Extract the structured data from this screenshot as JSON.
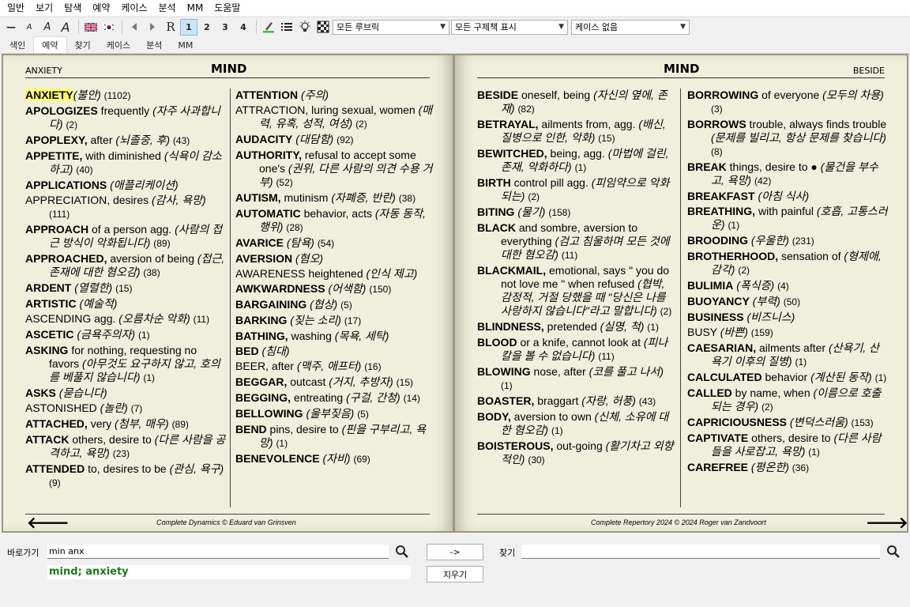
{
  "menu": [
    "일반",
    "보기",
    "탐색",
    "예약",
    "케이스",
    "분석",
    "MM",
    "도움말"
  ],
  "toolbar": {
    "size_buttons": [
      "—",
      "A",
      "A",
      "A"
    ],
    "r_label": "R",
    "level_buttons": [
      "1",
      "2",
      "3",
      "4"
    ],
    "rubric_filter": "모든 루브릭",
    "remedy_filter": "모든 구제책 표시",
    "case_select": "케이스 없음"
  },
  "tabs": [
    "색인",
    "예약",
    "찾기",
    "케이스",
    "분석",
    "MM"
  ],
  "left_page": {
    "header_left": "ANXIETY",
    "header_title": "MIND",
    "footer": "Complete Dynamics © Eduard van Grinsven",
    "col1": [
      {
        "b": "ANXIETY",
        "t": "",
        "i": "(불안)",
        "n": "(1102)",
        "hl": true
      },
      {
        "b": "APOLOGIZES",
        "t": " frequently ",
        "i": "(자주 사과합니다)",
        "n": "(2)"
      },
      {
        "b": "APOPLEXY,",
        "t": " after ",
        "i": "(뇌졸중, 후)",
        "n": "(43)"
      },
      {
        "b": "APPETITE,",
        "t": " with diminished ",
        "i": "(식욕이 감소하고)",
        "n": "(40)"
      },
      {
        "b": "APPLICATIONS",
        "t": " ",
        "i": "(애플리케이션)",
        "n": ""
      },
      {
        "b": "",
        "t": "APPRECIATION, desires ",
        "i": "(감사, 욕망)",
        "n": "(111)"
      },
      {
        "b": "APPROACH",
        "t": " of a person agg. ",
        "i": "(사람의 접근 방식이 악화됩니다)",
        "n": "(89)"
      },
      {
        "b": "APPROACHED,",
        "t": " aversion of being ",
        "i": "(접근, 존재에 대한 혐오감)",
        "n": "(38)"
      },
      {
        "b": "ARDENT",
        "t": " ",
        "i": "(열렬한)",
        "n": "(15)"
      },
      {
        "b": "ARTISTIC",
        "t": " ",
        "i": "(예술적)",
        "n": ""
      },
      {
        "b": "",
        "t": "ASCENDING agg. ",
        "i": "(오름차순 악화)",
        "n": "(11)"
      },
      {
        "b": "ASCETIC",
        "t": " ",
        "i": "(금욕주의자)",
        "n": "(1)"
      },
      {
        "b": "ASKING",
        "t": " for nothing, requesting no favors ",
        "i": "(아무것도 요구하지 않고, 호의를 베풀지 않습니다)",
        "n": "(1)"
      },
      {
        "b": "ASKS",
        "t": " ",
        "i": "(묻습니다)",
        "n": ""
      },
      {
        "b": "",
        "t": "ASTONISHED ",
        "i": "(놀란)",
        "n": "(7)"
      },
      {
        "b": "ATTACHED,",
        "t": " very ",
        "i": "(첨부, 매우)",
        "n": "(89)"
      },
      {
        "b": "ATTACK",
        "t": " others, desire to ",
        "i": "(다른 사람을 공격하고, 욕망)",
        "n": "(23)"
      },
      {
        "b": "ATTENDED",
        "t": " to, desires to be ",
        "i": "(관심, 욕구)",
        "n": "(9)"
      }
    ],
    "col2": [
      {
        "b": "ATTENTION",
        "t": " ",
        "i": "(주의)",
        "n": ""
      },
      {
        "b": "",
        "t": "ATTRACTION, luring sexual, women ",
        "i": "(매력, 유혹, 성적, 여성)",
        "n": "(2)"
      },
      {
        "b": "AUDACITY",
        "t": " ",
        "i": "(대담함)",
        "n": "(92)"
      },
      {
        "b": "AUTHORITY,",
        "t": " refusal to accept some one's ",
        "i": "(권위, 다른 사람의 의견 수용 거부)",
        "n": "(52)"
      },
      {
        "b": "AUTISM,",
        "t": " mutinism ",
        "i": "(자폐증, 반란)",
        "n": "(38)"
      },
      {
        "b": "AUTOMATIC",
        "t": " behavior, acts ",
        "i": "(자동 동작, 행위)",
        "n": "(28)"
      },
      {
        "b": "AVARICE",
        "t": " ",
        "i": "(탐욕)",
        "n": "(54)"
      },
      {
        "b": "AVERSION",
        "t": " ",
        "i": "(혐오)",
        "n": ""
      },
      {
        "b": "",
        "t": "AWARENESS heightened ",
        "i": "(인식 제고)",
        "n": ""
      },
      {
        "b": "AWKWARDNESS",
        "t": " ",
        "i": "(어색함)",
        "n": "(150)"
      },
      {
        "b": "BARGAINING",
        "t": " ",
        "i": "(협상)",
        "n": "(5)"
      },
      {
        "b": "BARKING",
        "t": " ",
        "i": "(짖는 소리)",
        "n": "(17)"
      },
      {
        "b": "BATHING,",
        "t": " washing ",
        "i": "(목욕, 세탁)",
        "n": ""
      },
      {
        "b": "BED",
        "t": " ",
        "i": "(침대)",
        "n": ""
      },
      {
        "b": "",
        "t": "BEER, after ",
        "i": "(맥주, 애프터)",
        "n": "(16)"
      },
      {
        "b": "BEGGAR,",
        "t": " outcast ",
        "i": "(거지, 추방자)",
        "n": "(15)"
      },
      {
        "b": "BEGGING,",
        "t": " entreating ",
        "i": "(구걸, 간청)",
        "n": "(14)"
      },
      {
        "b": "BELLOWING",
        "t": " ",
        "i": "(울부짖음)",
        "n": "(5)"
      },
      {
        "b": "BEND",
        "t": " pins, desire to ",
        "i": "(핀을 구부리고, 욕망)",
        "n": "(1)"
      },
      {
        "b": "BENEVOLENCE",
        "t": " ",
        "i": "(자비)",
        "n": "(69)"
      }
    ]
  },
  "right_page": {
    "header_title": "MIND",
    "header_right": "BESIDE",
    "footer": "Complete Repertory 2024 © 2024 Roger van Zandvoort",
    "col1": [
      {
        "b": "BESIDE",
        "t": " oneself, being ",
        "i": "(자신의 옆에, 존재)",
        "n": "(82)"
      },
      {
        "b": "BETRAYAL,",
        "t": " ailments from, agg. ",
        "i": "(배신, 질병으로 인한, 악화)",
        "n": "(15)"
      },
      {
        "b": "BEWITCHED,",
        "t": " being, agg. ",
        "i": "(마법에 걸린, 존재, 악화하다)",
        "n": "(1)"
      },
      {
        "b": "BIRTH",
        "t": " control pill agg. ",
        "i": "(피임약으로 악화되는)",
        "n": "(2)"
      },
      {
        "b": "BITING",
        "t": " ",
        "i": "(물기)",
        "n": "(158)"
      },
      {
        "b": "BLACK",
        "t": " and sombre, aversion to everything ",
        "i": "(검고 침울하며 모든 것에 대한 혐오감)",
        "n": "(11)"
      },
      {
        "b": "BLACKMAIL,",
        "t": " emotional, says \" you do not love me \" when refused ",
        "i": "(협박, 감정적, 거절 당했을 때 \"당신은 나를 사랑하지 않습니다\"라고 말합니다)",
        "n": "(2)"
      },
      {
        "b": "BLINDNESS,",
        "t": " pretended ",
        "i": "(실명, 척)",
        "n": "(1)"
      },
      {
        "b": "BLOOD",
        "t": " or a knife, cannot look at ",
        "i": "(피나 칼을 볼 수 없습니다)",
        "n": "(11)"
      },
      {
        "b": "BLOWING",
        "t": " nose, after ",
        "i": "(코를 풀고 나서)",
        "n": "(1)"
      },
      {
        "b": "BOASTER,",
        "t": " braggart ",
        "i": "(자랑, 허풍)",
        "n": "(43)"
      },
      {
        "b": "BODY,",
        "t": " aversion to own ",
        "i": "(신체, 소유에 대한 혐오감)",
        "n": "(1)"
      },
      {
        "b": "BOISTEROUS,",
        "t": " out-going ",
        "i": "(활기차고 외향적인)",
        "n": "(30)"
      }
    ],
    "col2": [
      {
        "b": "BORROWING",
        "t": " of everyone ",
        "i": "(모두의 차용)",
        "n": "(3)"
      },
      {
        "b": "BORROWS",
        "t": " trouble, always finds trouble ",
        "i": "(문제를 빌리고, 항상 문제를 찾습니다)",
        "n": "(8)"
      },
      {
        "b": "BREAK",
        "t": " things, desire to ● ",
        "i": "(물건을 부수고, 욕망)",
        "n": "(42)"
      },
      {
        "b": "BREAKFAST",
        "t": " ",
        "i": "(아침 식사)",
        "n": ""
      },
      {
        "b": "BREATHING,",
        "t": " with painful ",
        "i": "(호흡, 고통스러운)",
        "n": "(1)"
      },
      {
        "b": "BROODING",
        "t": " ",
        "i": "(우울한)",
        "n": "(231)"
      },
      {
        "b": "BROTHERHOOD,",
        "t": " sensation of ",
        "i": "(형제애, 감각)",
        "n": "(2)"
      },
      {
        "b": "BULIMIA",
        "t": " ",
        "i": "(폭식증)",
        "n": "(4)"
      },
      {
        "b": "BUOYANCY",
        "t": " ",
        "i": "(부력)",
        "n": "(50)"
      },
      {
        "b": "BUSINESS",
        "t": " ",
        "i": "(비즈니스)",
        "n": ""
      },
      {
        "b": "",
        "t": "BUSY ",
        "i": "(바쁜)",
        "n": "(159)"
      },
      {
        "b": "CAESARIAN,",
        "t": " ailments after ",
        "i": "(산욕기, 산욕기 이후의 질병)",
        "n": "(1)"
      },
      {
        "b": "CALCULATED",
        "t": " behavior ",
        "i": "(계산된 동작)",
        "n": "(1)"
      },
      {
        "b": "CALLED",
        "t": " by name, when ",
        "i": "(이름으로 호출되는 경우)",
        "n": "(2)"
      },
      {
        "b": "CAPRICIOUSNESS",
        "t": " ",
        "i": "(변덕스러움)",
        "n": "(153)"
      },
      {
        "b": "CAPTIVATE",
        "t": " others, desire to ",
        "i": "(다른 사람들을 사로잡고, 욕망)",
        "n": "(1)"
      },
      {
        "b": "CAREFREE",
        "t": " ",
        "i": "(평온한)",
        "n": "(36)"
      }
    ]
  },
  "bottom": {
    "goto_label": "바로가기",
    "goto_value": "min anx",
    "go_button": "->",
    "clear_button": "지우기",
    "find_label": "찾기",
    "find_value": "",
    "result": "mind; anxiety"
  }
}
